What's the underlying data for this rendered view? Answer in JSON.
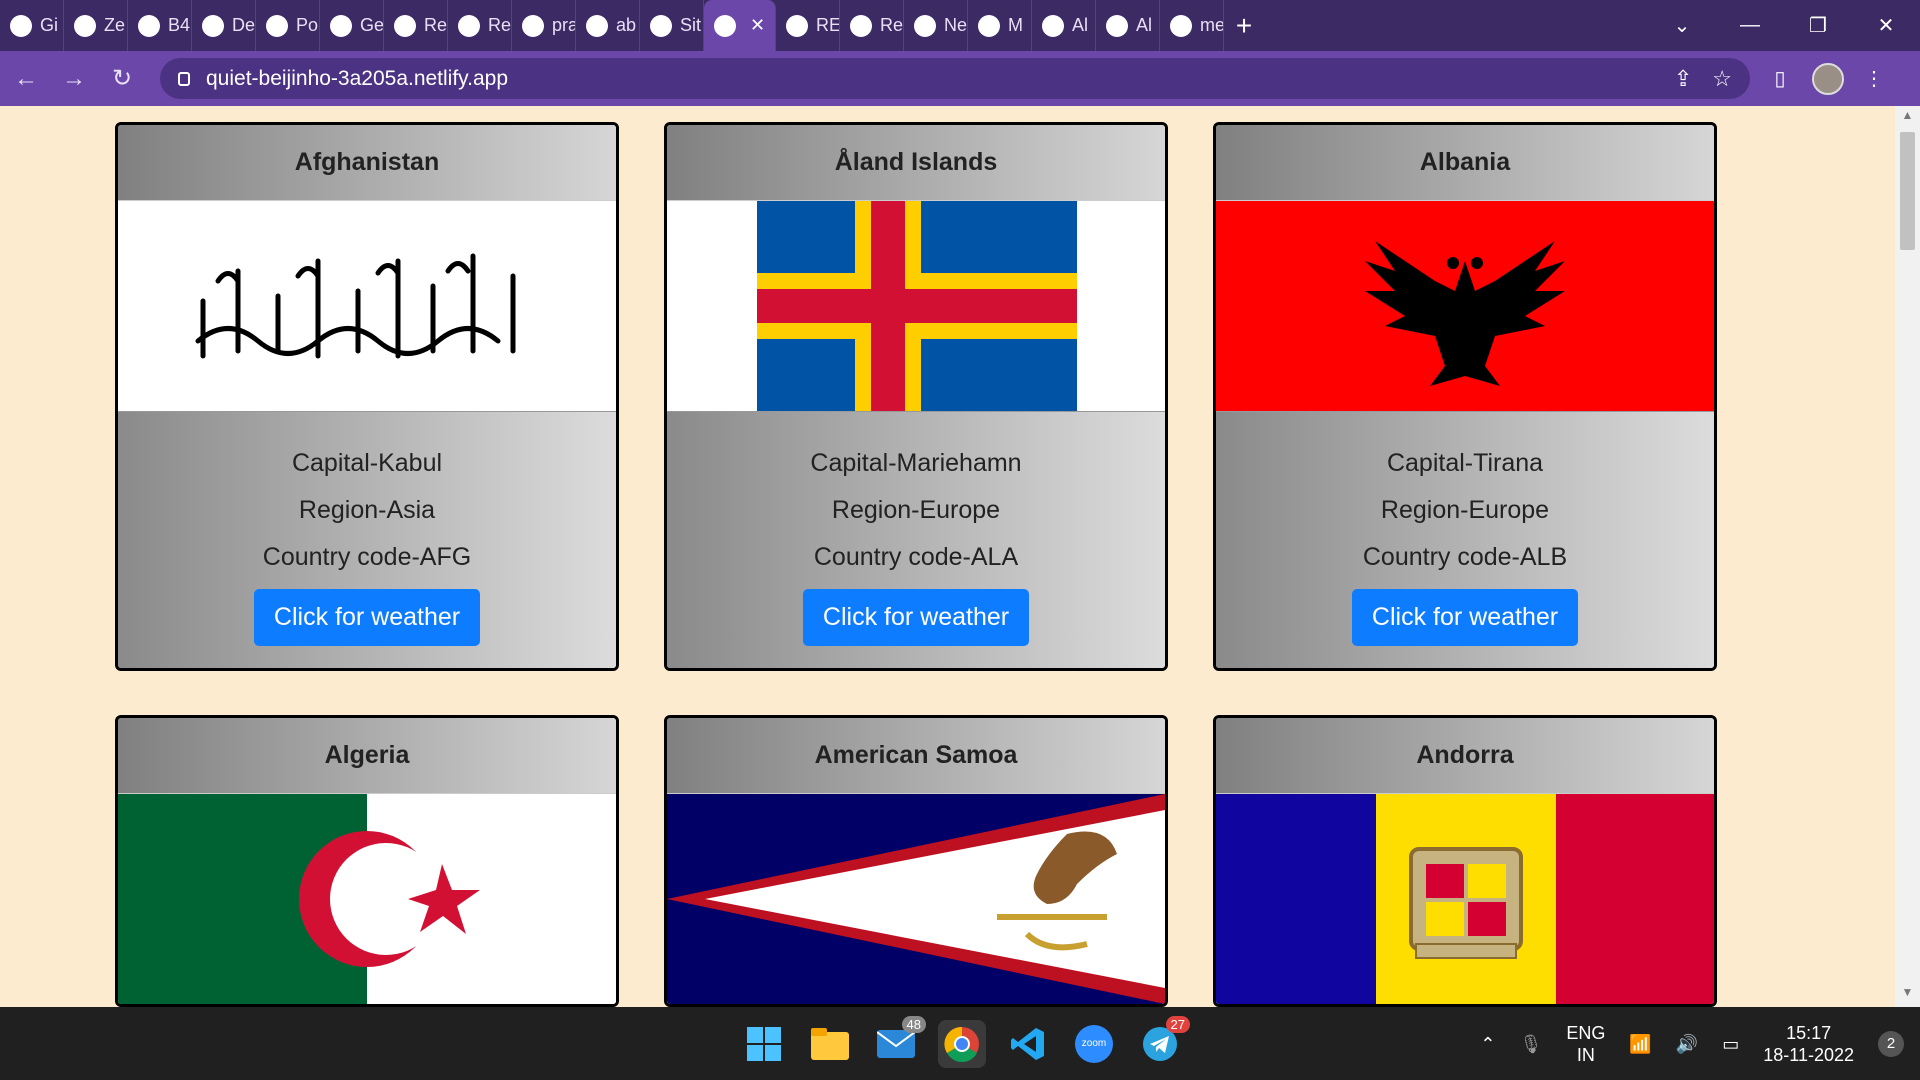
{
  "browser": {
    "tabs": [
      {
        "label": "Gi",
        "icon": "globe-icon"
      },
      {
        "label": "Ze",
        "icon": "zen-icon"
      },
      {
        "label": "B4",
        "icon": "zoom-icon"
      },
      {
        "label": "De",
        "icon": "r-icon"
      },
      {
        "label": "Po",
        "icon": "zoom-icon"
      },
      {
        "label": "Ge",
        "icon": "react-icon"
      },
      {
        "label": "Re",
        "icon": "slides-icon"
      },
      {
        "label": "Re",
        "icon": "react-icon"
      },
      {
        "label": "pra",
        "icon": "square-icon"
      },
      {
        "label": "ab",
        "icon": "github-icon"
      },
      {
        "label": "Sit",
        "icon": "diamond-icon"
      },
      {
        "label": "",
        "icon": "globe-icon",
        "active": true
      },
      {
        "label": "RE",
        "icon": "globe-icon"
      },
      {
        "label": "Re",
        "icon": "react-icon"
      },
      {
        "label": "Ne",
        "icon": "globe-icon"
      },
      {
        "label": "M",
        "icon": "drive-icon"
      },
      {
        "label": "Al",
        "icon": "drive-icon"
      },
      {
        "label": "Al",
        "icon": "globe-icon"
      },
      {
        "label": "me",
        "icon": "linkedin-icon"
      }
    ],
    "url": "quiet-beijinho-3a205a.netlify.app"
  },
  "cards": [
    {
      "name": "Afghanistan",
      "capital": "Capital-Kabul",
      "region": "Region-Asia",
      "code": "Country code-AFG",
      "button": "Click for weather",
      "flag": "afghanistan"
    },
    {
      "name": "Åland Islands",
      "capital": "Capital-Mariehamn",
      "region": "Region-Europe",
      "code": "Country code-ALA",
      "button": "Click for weather",
      "flag": "aland"
    },
    {
      "name": "Albania",
      "capital": "Capital-Tirana",
      "region": "Region-Europe",
      "code": "Country code-ALB",
      "button": "Click for weather",
      "flag": "albania"
    },
    {
      "name": "Algeria",
      "flag": "algeria"
    },
    {
      "name": "American Samoa",
      "flag": "american-samoa"
    },
    {
      "name": "Andorra",
      "flag": "andorra"
    }
  ],
  "taskbar": {
    "mail_badge": "48",
    "telegram_badge": "27",
    "zoom_label": "zoom",
    "lang_top": "ENG",
    "lang_bottom": "IN",
    "time": "15:17",
    "date": "18-11-2022",
    "notifications": "2"
  },
  "colors": {
    "page_bg": "#fdebd0",
    "button": "#0d7cff",
    "tabstrip": "#3b2a63",
    "toolbar": "#6a47a8"
  }
}
